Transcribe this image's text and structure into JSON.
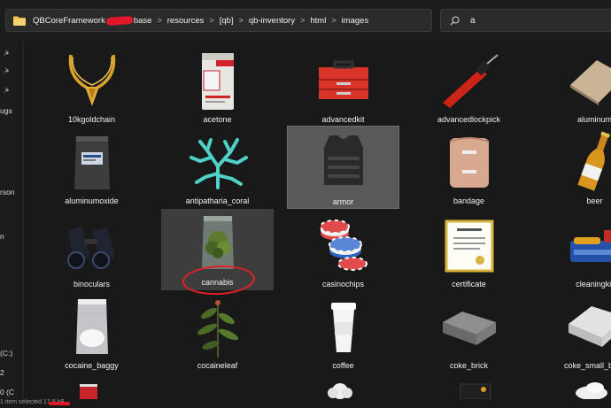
{
  "breadcrumb": {
    "items": [
      "QBCoreFramework",
      "base",
      "resources",
      "[qb]",
      "qb-inventory",
      "html",
      "images"
    ]
  },
  "search": {
    "query": "a"
  },
  "nav": {
    "labels": [
      "ugs",
      "rson",
      "n",
      "(C:)",
      "2",
      "0 (C"
    ]
  },
  "files": [
    {
      "name": "10kgoldchain",
      "icon": "gold-chain-icon"
    },
    {
      "name": "acetone",
      "icon": "acetone-can-icon"
    },
    {
      "name": "advancedkit",
      "icon": "red-toolbox-icon"
    },
    {
      "name": "advancedlockpick",
      "icon": "lockpick-drill-icon"
    },
    {
      "name": "aluminum",
      "icon": "aluminum-sheet-icon"
    },
    {
      "name": "aluminumoxide",
      "icon": "powder-bag-icon"
    },
    {
      "name": "antipatharia_coral",
      "icon": "coral-icon"
    },
    {
      "name": "armor",
      "icon": "body-armor-icon"
    },
    {
      "name": "bandage",
      "icon": "bandage-roll-icon"
    },
    {
      "name": "beer",
      "icon": "beer-bottle-icon"
    },
    {
      "name": "binoculars",
      "icon": "binoculars-icon"
    },
    {
      "name": "cannabis",
      "icon": "cannabis-bag-icon"
    },
    {
      "name": "casinochips",
      "icon": "casino-chips-icon"
    },
    {
      "name": "certificate",
      "icon": "certificate-icon"
    },
    {
      "name": "cleaningkit",
      "icon": "cleaning-kit-icon"
    },
    {
      "name": "cocaine_baggy",
      "icon": "white-baggy-icon"
    },
    {
      "name": "cocaineleaf",
      "icon": "leaf-plant-icon"
    },
    {
      "name": "coffee",
      "icon": "coffee-cup-icon"
    },
    {
      "name": "coke_brick",
      "icon": "brick-package-icon"
    },
    {
      "name": "coke_small_brick",
      "icon": "small-brick-icon"
    }
  ],
  "status": {
    "text": "1 item selected  17.8 kB"
  }
}
